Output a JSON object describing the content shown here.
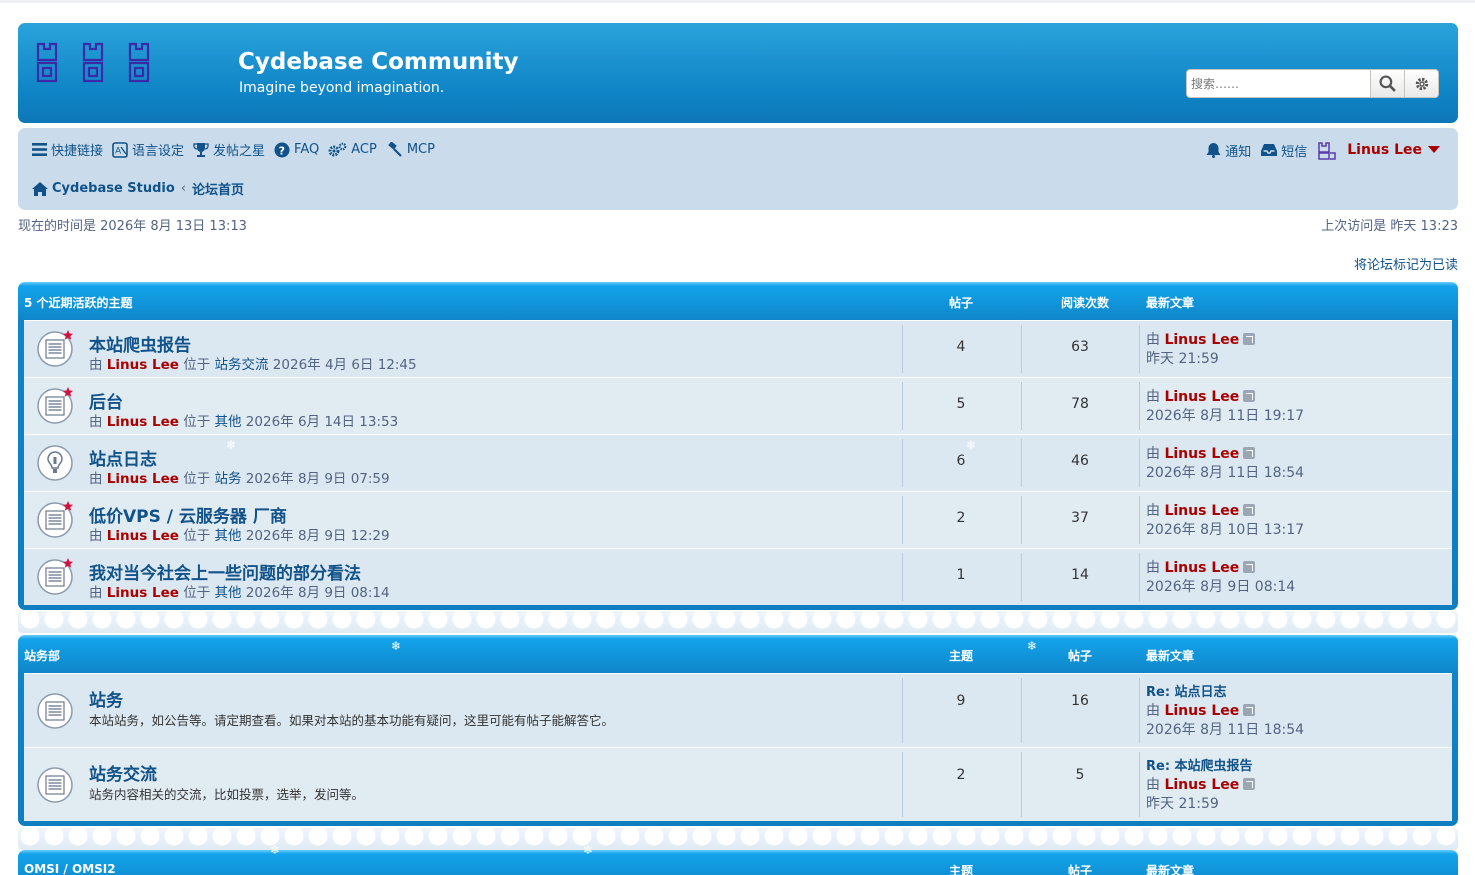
{
  "header": {
    "title": "Cydebase Community",
    "subtitle": "Imagine beyond imagination.",
    "search_placeholder": "搜索……"
  },
  "nav": {
    "quick_links": "快捷链接",
    "language": "语言设定",
    "star": "发帖之星",
    "faq": "FAQ",
    "acp": "ACP",
    "mcp": "MCP",
    "notifications": "通知",
    "messages": "短信",
    "username": "Linus Lee"
  },
  "breadcrumb": {
    "home": "Cydebase Studio",
    "index": "论坛首页"
  },
  "status": {
    "current_time": "现在的时间是 2026年 8月 13日 13:13",
    "last_visit": "上次访问是 昨天 13:23",
    "mark_read": "将论坛标记为已读"
  },
  "active_topics": {
    "header": "5 个近期活跃的主题",
    "col_posts": "帖子",
    "col_views": "阅读次数",
    "col_last": "最新文章",
    "rows": [
      {
        "title": "本站爬虫报告",
        "by": "由",
        "author": "Linus Lee",
        "in": "位于",
        "forum": "站务交流",
        "date": "2026年 4月 6日 12:45",
        "posts": "4",
        "views": "63",
        "last_by": "由",
        "last_author": "Linus Lee",
        "last_time": "昨天 21:59",
        "icon": "topic-unread-icon"
      },
      {
        "title": "后台",
        "by": "由",
        "author": "Linus Lee",
        "in": "位于",
        "forum": "其他",
        "date": "2026年 6月 14日 13:53",
        "posts": "5",
        "views": "78",
        "last_by": "由",
        "last_author": "Linus Lee",
        "last_time": "2026年 8月 11日 19:17",
        "icon": "topic-unread-icon"
      },
      {
        "title": "站点日志",
        "by": "由",
        "author": "Linus Lee",
        "in": "位于",
        "forum": "站务",
        "date": "2026年 8月 9日 07:59",
        "posts": "6",
        "views": "46",
        "last_by": "由",
        "last_author": "Linus Lee",
        "last_time": "2026年 8月 11日 18:54",
        "icon": "sticky-icon"
      },
      {
        "title": "低价VPS / 云服务器 厂商",
        "by": "由",
        "author": "Linus Lee",
        "in": "位于",
        "forum": "其他",
        "date": "2026年 8月 9日 12:29",
        "posts": "2",
        "views": "37",
        "last_by": "由",
        "last_author": "Linus Lee",
        "last_time": "2026年 8月 10日 13:17",
        "icon": "topic-unread-icon"
      },
      {
        "title": "我对当今社会上一些问题的部分看法",
        "by": "由",
        "author": "Linus Lee",
        "in": "位于",
        "forum": "其他",
        "date": "2026年 8月 9日 08:14",
        "posts": "1",
        "views": "14",
        "last_by": "由",
        "last_author": "Linus Lee",
        "last_time": "2026年 8月 9日 08:14",
        "icon": "topic-unread-icon"
      }
    ]
  },
  "category_site": {
    "header": "站务部",
    "col_topics": "主题",
    "col_posts": "帖子",
    "col_last": "最新文章",
    "rows": [
      {
        "title": "站务",
        "desc": "本站站务，如公告等。请定期查看。如果对本站的基本功能有疑问，这里可能有帖子能解答它。",
        "topics": "9",
        "posts": "16",
        "last_subject": "Re: 站点日志",
        "last_by": "由",
        "last_author": "Linus Lee",
        "last_time": "2026年 8月 11日 18:54"
      },
      {
        "title": "站务交流",
        "desc": "站务内容相关的交流，比如投票，选举，发问等。",
        "topics": "2",
        "posts": "5",
        "last_subject": "Re: 本站爬虫报告",
        "last_by": "由",
        "last_author": "Linus Lee",
        "last_time": "昨天 21:59"
      }
    ]
  },
  "category_omsi": {
    "header": "OMSI / OMSI2",
    "col_topics": "主题",
    "col_posts": "帖子",
    "col_last": "最新文章"
  },
  "colors": {
    "header_blue": "#0f84c6",
    "link_blue": "#105289",
    "author_red": "#aa0000",
    "row_bg": "#dce8f1"
  }
}
